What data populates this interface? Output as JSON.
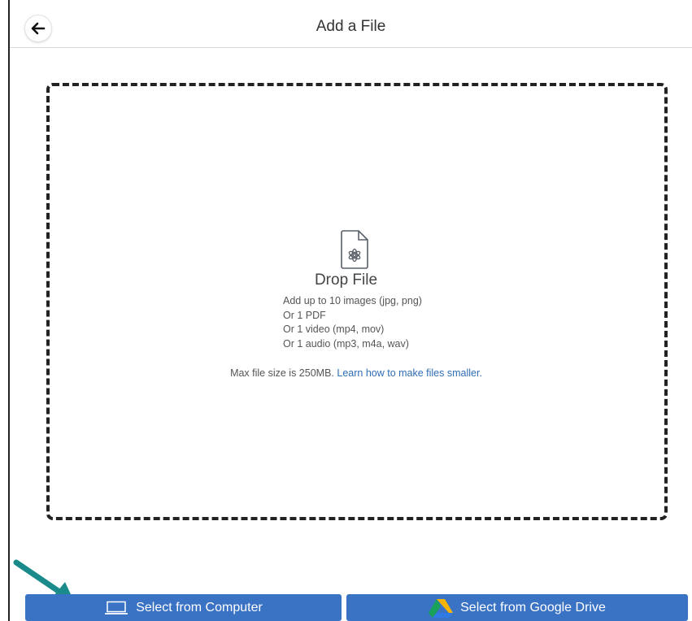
{
  "header": {
    "title": "Add a File",
    "back_icon": "arrow-left-icon"
  },
  "drop_zone": {
    "icon": "file-icon",
    "title": "Drop File",
    "hints": [
      "Add up to 10 images (jpg, png)",
      "Or 1 PDF",
      "Or 1 video (mp4, mov)",
      "Or 1 audio (mp3, m4a, wav)"
    ],
    "max_size_text": "Max file size is 250MB.",
    "learn_link": "Learn how to make files smaller."
  },
  "buttons": {
    "computer_label": "Select from Computer",
    "computer_icon": "laptop-icon",
    "drive_label": "Select from Google Drive",
    "drive_icon": "google-drive-icon"
  },
  "colors": {
    "button_bg": "#3a72c4",
    "link": "#2f6db5",
    "annotation_arrow": "#1a8a8a"
  }
}
